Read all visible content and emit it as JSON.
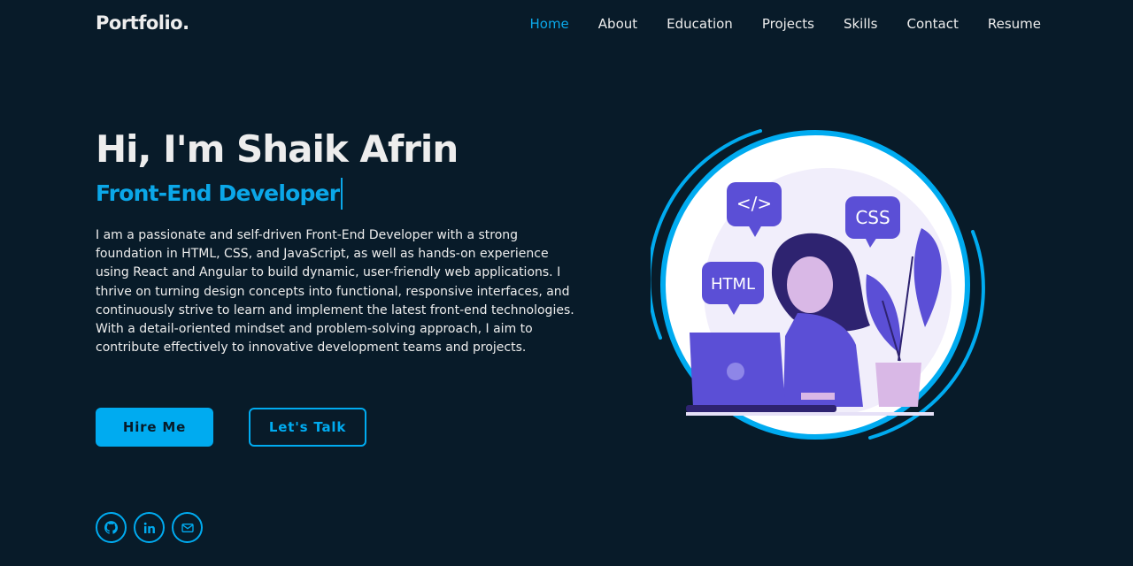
{
  "header": {
    "logo": "Portfolio.",
    "nav": [
      {
        "label": "Home",
        "active": true
      },
      {
        "label": "About",
        "active": false
      },
      {
        "label": "Education",
        "active": false
      },
      {
        "label": "Projects",
        "active": false
      },
      {
        "label": "Skills",
        "active": false
      },
      {
        "label": "Contact",
        "active": false
      },
      {
        "label": "Resume",
        "active": false
      }
    ]
  },
  "hero": {
    "title": "Hi, I'm Shaik Afrin",
    "subtitle": "Front-End Developer",
    "description": "I am a passionate and self-driven Front-End Developer with a strong foundation in HTML, CSS, and JavaScript, as well as hands-on experience using React and Angular to build dynamic, user-friendly web applications. I thrive on turning design concepts into functional, responsive interfaces, and continuously strive to learn and implement the latest front-end technologies. With a detail-oriented mindset and problem-solving approach, I aim to contribute effectively to innovative development teams and projects.",
    "buttons": {
      "primary": "Hire Me",
      "secondary": "Let's Talk"
    }
  },
  "illustration": {
    "bubble_code": "</>",
    "bubble_css": "CSS",
    "bubble_html": "HTML"
  },
  "socials": [
    {
      "icon": "github-icon"
    },
    {
      "icon": "linkedin-icon"
    },
    {
      "icon": "mail-icon"
    }
  ],
  "colors": {
    "background": "#081b29",
    "accent": "#00abf0",
    "text": "#ededed",
    "illustration_purple": "#5b4fd6"
  }
}
